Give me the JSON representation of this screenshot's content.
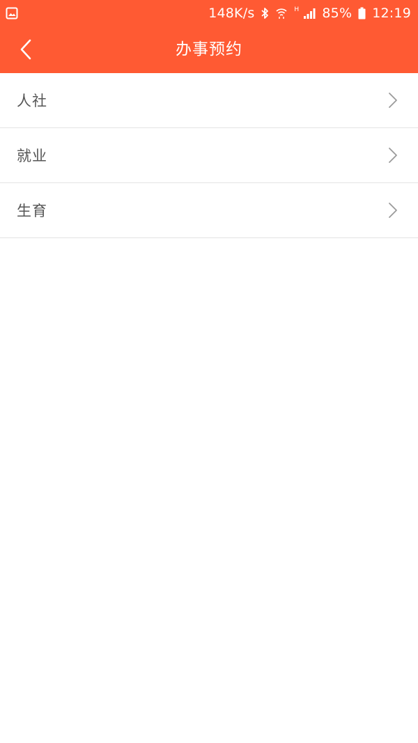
{
  "status_bar": {
    "gallery_icon": "image-icon",
    "network_speed": "148K/s",
    "bluetooth_icon": "bluetooth-icon",
    "wifi_icon": "wifi-icon",
    "network_type": "H",
    "signal_icon": "signal-icon",
    "battery_percent": "85%",
    "battery_icon": "battery-icon",
    "time": "12:19"
  },
  "header": {
    "back_icon": "chevron-left-icon",
    "title": "办事预约"
  },
  "list": {
    "items": [
      {
        "label": "人社",
        "icon": "chevron-right-icon"
      },
      {
        "label": "就业",
        "icon": "chevron-right-icon"
      },
      {
        "label": "生育",
        "icon": "chevron-right-icon"
      }
    ]
  },
  "colors": {
    "accent": "#ff5a33",
    "divider": "#e3e3e3",
    "label_text": "#555555",
    "chevron": "#9a9a9a",
    "background": "#ffffff"
  }
}
